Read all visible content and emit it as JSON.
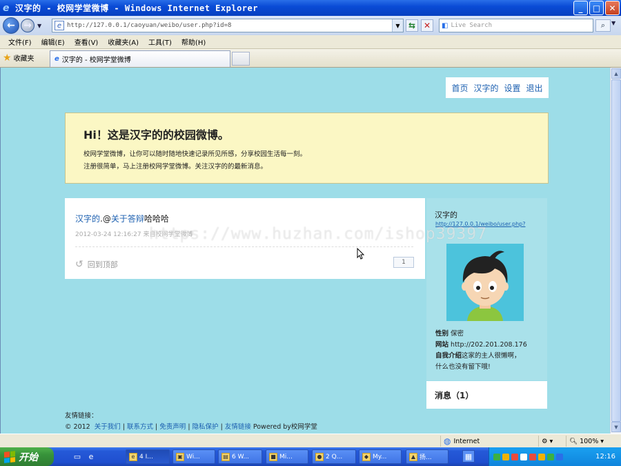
{
  "window": {
    "title": "汉字的 - 校网学堂微博 - Windows Internet Explorer",
    "buttons": [
      "_",
      "□",
      "X"
    ]
  },
  "address_bar": {
    "url": "http://127.0.0.1/caoyuan/weibo/user.php?id=8",
    "search_placeholder": "Live Search"
  },
  "menu": [
    "文件(F)",
    "编辑(E)",
    "查看(V)",
    "收藏夹(A)",
    "工具(T)",
    "帮助(H)"
  ],
  "favorites": {
    "label": "收藏夹",
    "tab_title": "汉字的 - 校网学堂微博"
  },
  "top_nav": [
    "首页",
    "汉字的",
    "设置",
    "退出"
  ],
  "welcome": {
    "title": "Hi！这是汉字的的校园微博。",
    "line1": "校网学堂微博，让你可以随时随地快速记录所见所感，分享校园生活每一刻。",
    "line2": "注册很简单，马上注册校网学堂微博。关注汉字的的最新消息。"
  },
  "post": {
    "author": "汉字的",
    "mention_prefix": ".@",
    "mention": "关于答辩",
    "text": "哈哈哈",
    "meta": "2012-03-24 12:16:27 来自校网学堂微博",
    "reply_label": "回到顶部",
    "count": "1"
  },
  "profile": {
    "name": "汉字的",
    "link": "http://127.0.0.1/weibo/user.php?",
    "gender_label": "性别",
    "gender": "保密",
    "site_label": "网站",
    "site": "http://202.201.208.176",
    "bio_label": "自我介绍",
    "bio": "这家的主人很懒啊，",
    "bio2": "什么也没有留下哦!"
  },
  "messages": {
    "label": "消息（1）"
  },
  "footer": {
    "links_label": "友情链接：",
    "copyright": "© 2012",
    "links": [
      "关于我们",
      "联系方式",
      "免责声明",
      "隐私保护",
      "友情链接"
    ],
    "powered": "Powered by校网学堂"
  },
  "watermark": "https://www.huzhan.com/ishop39397",
  "status_bar": {
    "zone": "Internet",
    "zoom": "100%"
  },
  "taskbar": {
    "start": "开始",
    "tasks": [
      "4 I...",
      "Wi...",
      "6 W...",
      "Mi...",
      "2 Q...",
      "My...",
      "扬..."
    ],
    "clock": "12:16"
  },
  "colors": {
    "page_bg": "#9ddde8",
    "welcome_bg": "#fbf7c4",
    "link": "#1b5fb0",
    "titlebar": "#0a4bd6"
  }
}
